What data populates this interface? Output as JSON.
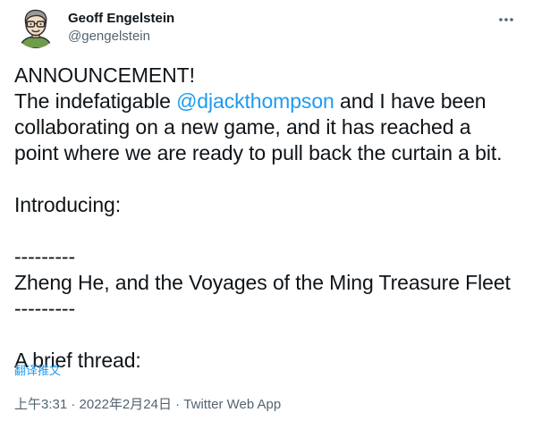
{
  "author": {
    "display_name": "Geoff Engelstein",
    "handle": "@gengelstein"
  },
  "tweet": {
    "line1": "ANNOUNCEMENT!",
    "line2_before": "The indefatigable ",
    "mention": "@djackthompson",
    "line2_after": " and I have been",
    "line3": "collaborating on a new game, and it has reached a",
    "line4": "point where we are ready to pull back the curtain a bit.",
    "line5": "Introducing:",
    "line6": "---------",
    "line7": "Zheng He, and the Voyages of the Ming Treasure Fleet",
    "line8": "---------",
    "line9": "A brief thread:",
    "translate_label": "翻译推文"
  },
  "meta": {
    "time": "上午3:31",
    "separator": " · ",
    "date": "2022年2月24日",
    "source": "Twitter Web App"
  },
  "icons": {
    "more": "more-horizontal-icon",
    "avatar": "cartoon-portrait-avatar"
  },
  "colors": {
    "link": "#1d9bf0",
    "text": "#0f1419",
    "secondary": "#536471"
  }
}
